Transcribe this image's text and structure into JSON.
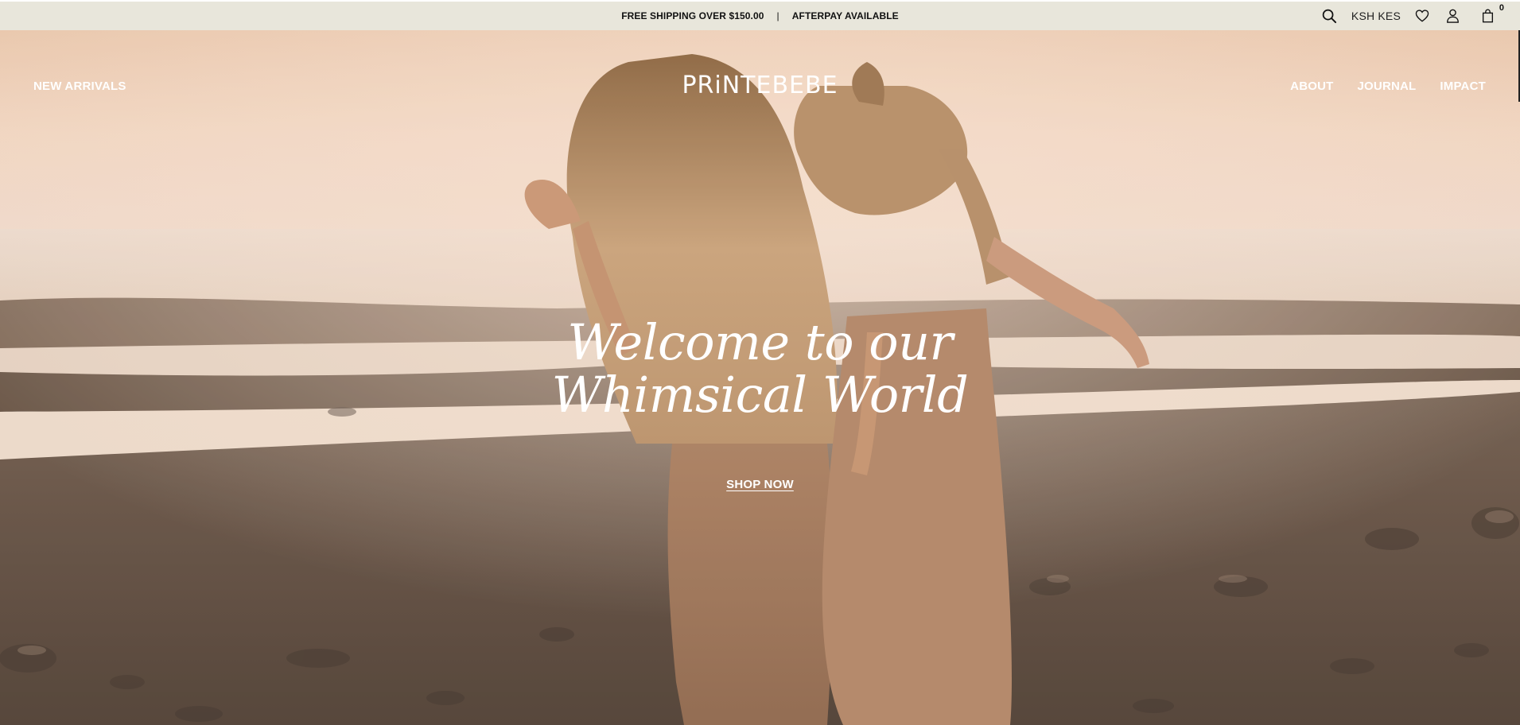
{
  "announcement": {
    "left_text": "FREE SHIPPING OVER $150.00",
    "separator": "|",
    "right_text": "AFTERPAY AVAILABLE"
  },
  "utility": {
    "currency": "KSH KES",
    "cart_count": "0",
    "icons": [
      "search-icon",
      "heart-icon",
      "account-icon",
      "bag-icon"
    ]
  },
  "header": {
    "logo": "PRiNTEBEBE",
    "nav_left": "NEW ARRIVALS",
    "nav_right": [
      "ABOUT",
      "JOURNAL",
      "IMPACT"
    ]
  },
  "hero": {
    "title_line1": "Welcome to our",
    "title_line2": "Whimsical World",
    "cta": "SHOP NOW"
  },
  "colors": {
    "announcement_bg": "#e8e6db",
    "text_dark": "#111111",
    "hero_text": "#ffffff"
  }
}
